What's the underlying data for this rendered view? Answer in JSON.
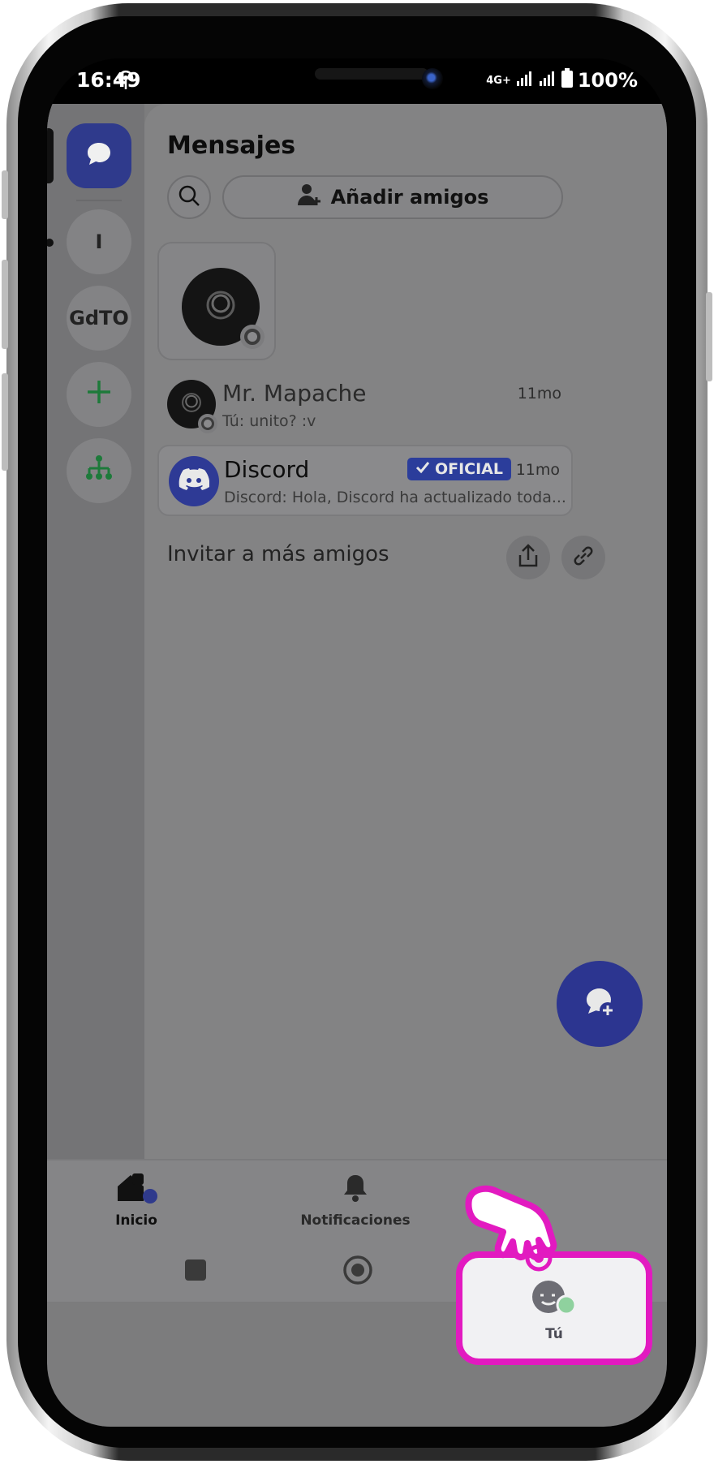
{
  "status_bar": {
    "time": "16:49",
    "network": "4G+",
    "battery": "100%"
  },
  "rail": {
    "servers": [
      {
        "label": "I"
      },
      {
        "label": "GdTO"
      }
    ]
  },
  "header": {
    "title": "Mensajes",
    "add_friends_label": "Añadir amigos"
  },
  "conversations": [
    {
      "name": "Mr. Mapache",
      "preview": "Tú: unito? :v",
      "time": "11mo"
    },
    {
      "name": "Discord",
      "badge": "OFICIAL",
      "preview": "Discord: Hola, Discord ha actualizado toda...",
      "time": "11mo"
    }
  ],
  "invite": {
    "label": "Invitar a más amigos"
  },
  "bottom_nav": {
    "home_label": "Inicio",
    "notifications_label": "Notificaciones",
    "you_label": "Tú"
  },
  "colors": {
    "accent": "#2f3a8c",
    "highlight": "#e21ac0",
    "online": "#8fd19e"
  }
}
